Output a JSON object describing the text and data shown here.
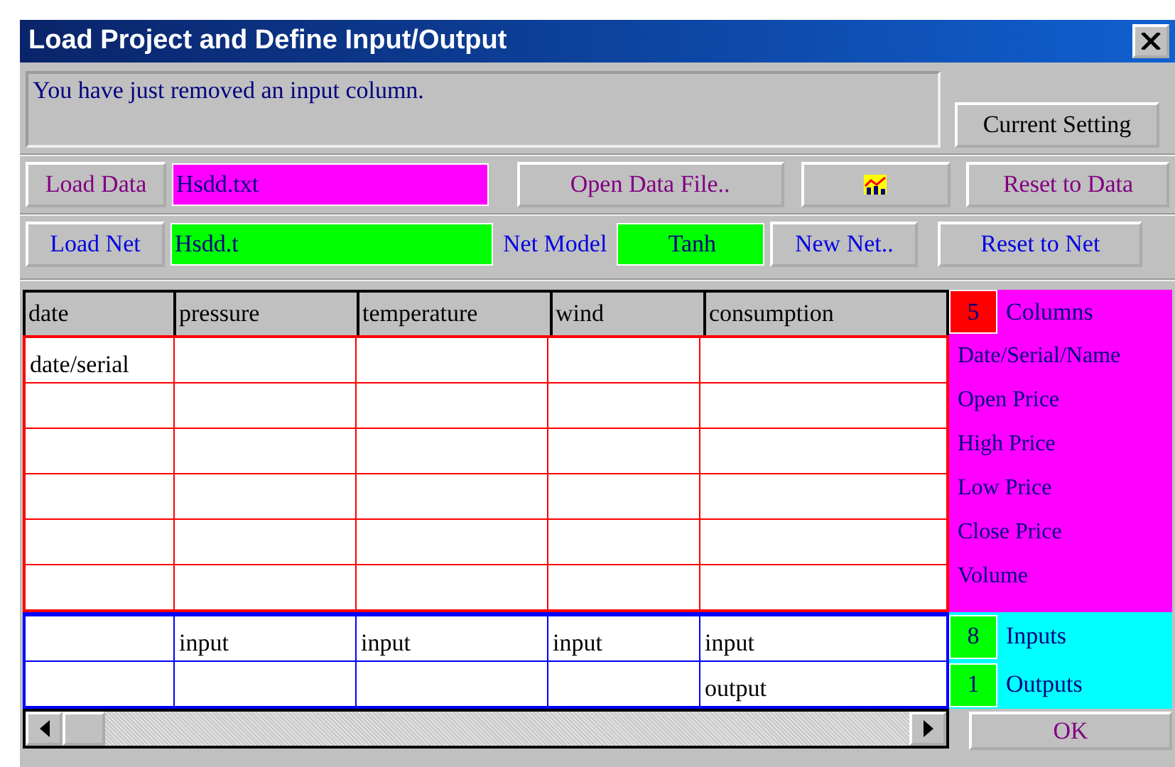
{
  "window": {
    "title": "Load Project and Define Input/Output"
  },
  "message": "You have just removed an input column.",
  "current_setting_button": "Current Setting",
  "data_row": {
    "load_button": "Load Data",
    "file": "Hsdd.txt",
    "open_button": "Open Data File..",
    "reset_button": "Reset to Data"
  },
  "net_row": {
    "load_button": "Load Net",
    "file": "Hsdd.t",
    "model_label": "Net Model",
    "model": "Tanh",
    "new_button": "New Net..",
    "reset_button": "Reset to Net"
  },
  "table": {
    "columns": [
      "date",
      "pressure",
      "temperature",
      "wind",
      "consumption"
    ],
    "data_rows": [
      [
        "date/serial",
        "",
        "",
        "",
        ""
      ],
      [
        "",
        "",
        "",
        "",
        ""
      ],
      [
        "",
        "",
        "",
        "",
        ""
      ],
      [
        "",
        "",
        "",
        "",
        ""
      ],
      [
        "",
        "",
        "",
        "",
        ""
      ],
      [
        "",
        "",
        "",
        "",
        ""
      ]
    ],
    "role_rows": [
      [
        "",
        "input",
        "input",
        "input",
        "input"
      ],
      [
        "",
        "",
        "",
        "",
        "output"
      ]
    ]
  },
  "side_panel": {
    "columns_count": "5",
    "columns_label": "Columns",
    "field_names": [
      "Date/Serial/Name",
      "Open Price",
      "High Price",
      "Low Price",
      "Close Price",
      "Volume"
    ],
    "inputs_count": "8",
    "inputs_label": "Inputs",
    "outputs_count": "1",
    "outputs_label": "Outputs"
  },
  "ok_button": "OK"
}
